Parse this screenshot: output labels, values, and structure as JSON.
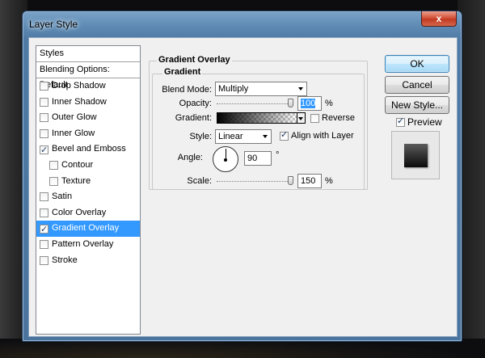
{
  "window": {
    "title": "Layer Style",
    "close_glyph": "x"
  },
  "styles_panel": {
    "header": "Styles",
    "blending_options": "Blending Options: Default",
    "items": [
      {
        "label": "Drop Shadow",
        "checked": false,
        "sub": false,
        "selected": false
      },
      {
        "label": "Inner Shadow",
        "checked": false,
        "sub": false,
        "selected": false
      },
      {
        "label": "Outer Glow",
        "checked": false,
        "sub": false,
        "selected": false
      },
      {
        "label": "Inner Glow",
        "checked": false,
        "sub": false,
        "selected": false
      },
      {
        "label": "Bevel and Emboss",
        "checked": true,
        "sub": false,
        "selected": false
      },
      {
        "label": "Contour",
        "checked": false,
        "sub": true,
        "selected": false
      },
      {
        "label": "Texture",
        "checked": false,
        "sub": true,
        "selected": false
      },
      {
        "label": "Satin",
        "checked": false,
        "sub": false,
        "selected": false
      },
      {
        "label": "Color Overlay",
        "checked": false,
        "sub": false,
        "selected": false
      },
      {
        "label": "Gradient Overlay",
        "checked": true,
        "sub": false,
        "selected": true
      },
      {
        "label": "Pattern Overlay",
        "checked": false,
        "sub": false,
        "selected": false
      },
      {
        "label": "Stroke",
        "checked": false,
        "sub": false,
        "selected": false
      }
    ]
  },
  "gradient_overlay": {
    "section_title": "Gradient Overlay",
    "group_title": "Gradient",
    "blend_mode": {
      "label": "Blend Mode:",
      "value": "Multiply"
    },
    "opacity": {
      "label": "Opacity:",
      "value": "100",
      "unit": "%",
      "level": 1.0
    },
    "gradient": {
      "label": "Gradient:",
      "from_color": "#000000",
      "to": "transparent"
    },
    "reverse": {
      "label": "Reverse",
      "checked": false
    },
    "style": {
      "label": "Style:",
      "value": "Linear"
    },
    "align_with_layer": {
      "label": "Align with Layer",
      "checked": true
    },
    "angle": {
      "label": "Angle:",
      "value": "90",
      "unit": "°"
    },
    "scale": {
      "label": "Scale:",
      "value": "150",
      "unit": "%",
      "level": 1.0
    }
  },
  "buttons": {
    "ok": "OK",
    "cancel": "Cancel",
    "new_style": "New Style..."
  },
  "preview": {
    "label": "Preview",
    "checked": true
  },
  "colors": {
    "selection": "#3399ff",
    "titlebar": "#5f8bb4",
    "dialog_bg": "#f0f0f0"
  }
}
